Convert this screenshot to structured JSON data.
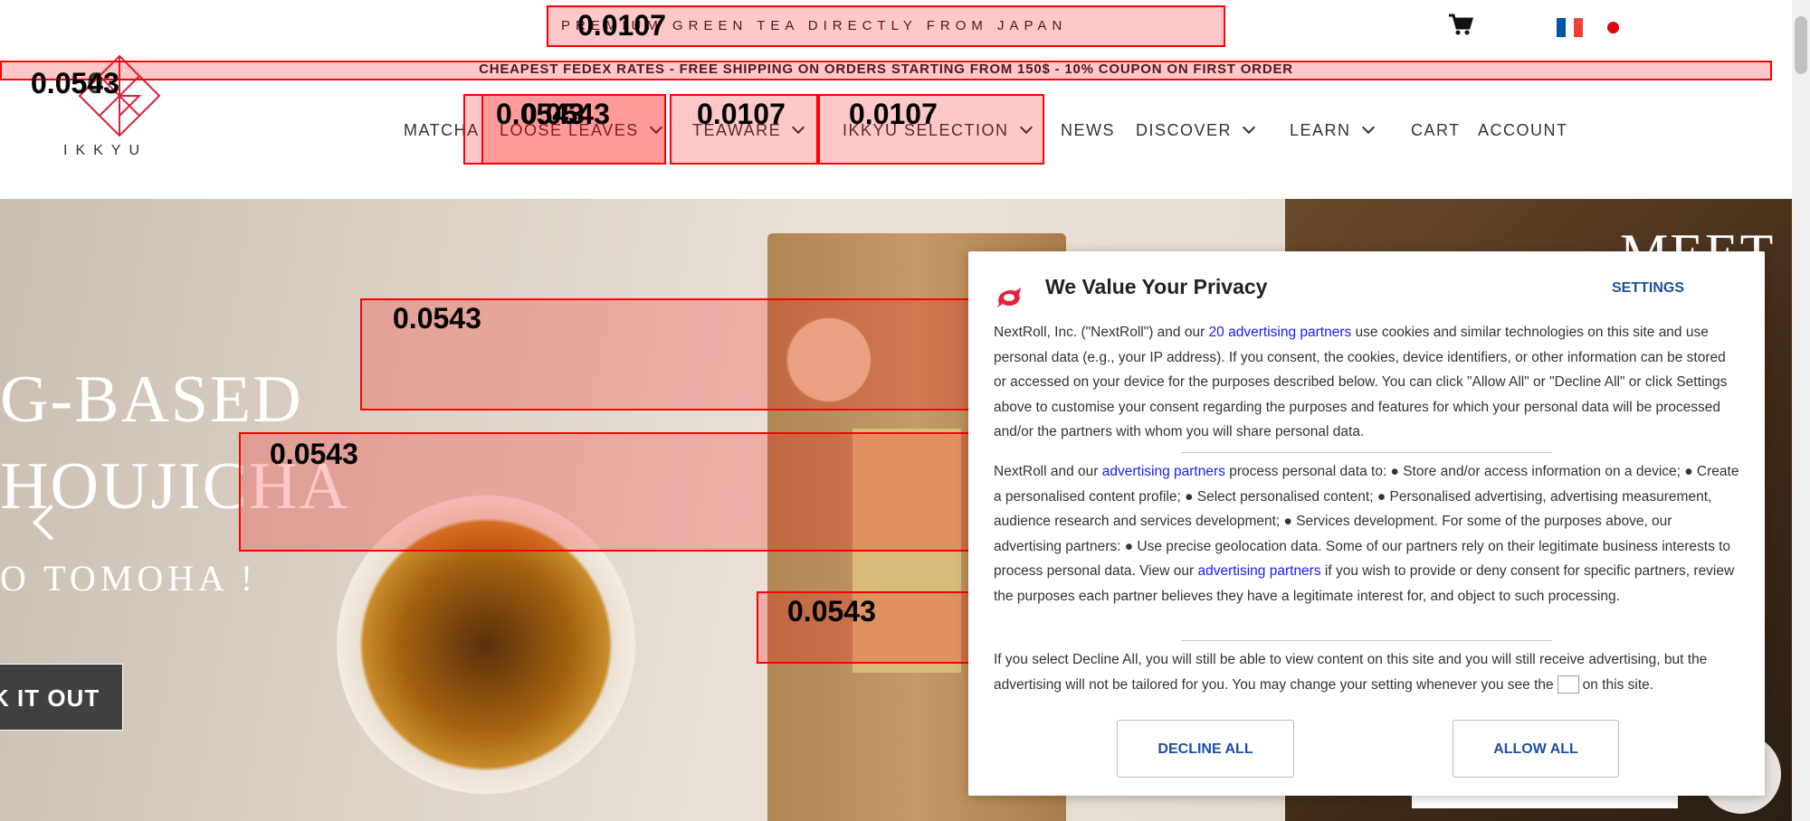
{
  "topbar": {
    "tagline": "PREMIUM GREEN TEA DIRECTLY FROM JAPAN"
  },
  "shipping": {
    "text": "CHEAPEST FEDEX RATES - FREE SHIPPING ON ORDERS STARTING FROM 150$ - 10% COUPON ON FIRST ORDER"
  },
  "brand": {
    "name": "IKKYU"
  },
  "nav": {
    "items": [
      {
        "label": "MATCHA"
      },
      {
        "label": "LOOSE LEAVES"
      },
      {
        "label": "TEAWARE"
      },
      {
        "label": "IKKYU SELECTION"
      },
      {
        "label": "NEWS"
      },
      {
        "label": "DISCOVER"
      },
      {
        "label": "LEARN"
      },
      {
        "label": "CART"
      },
      {
        "label": "ACCOUNT"
      }
    ]
  },
  "hero": {
    "line1": "G-BASED",
    "line2": "HOUJICHA",
    "line3": "O TOMOHA !",
    "button": "K IT OUT",
    "right_title": "MEET"
  },
  "overlay_labels": [
    "0.0107",
    "0.0543",
    "0.0503",
    "0.0543",
    "0.0107",
    "0.0107",
    "0.0543",
    "0.0543",
    "0.0543",
    "0.0543"
  ],
  "modal": {
    "title": "We Value Your Privacy",
    "settings": "SETTINGS",
    "p1_a": "NextRoll, Inc. (\"NextRoll\") and our ",
    "p1_link": "20 advertising partners",
    "p1_b": " use cookies and similar technologies on this site and use personal data (e.g., your IP address). If you consent, the cookies, device identifiers, or other information can be stored or accessed on your device for the purposes described below. You can click \"Allow All\" or \"Decline All\" or click Settings above to customise your consent regarding the purposes and features for which your personal data will be processed and/or the partners with whom you will share personal data.",
    "p2_a": "NextRoll and our ",
    "p2_link1": "advertising partners",
    "p2_b": " process personal data to: ● Store and/or access information on a device; ● Create a personalised content profile; ● Select personalised content; ● Personalised advertising, advertising measurement, audience research and services development; ● Services development. For some of the purposes above, our advertising partners: ● Use precise geolocation data. Some of our partners rely on their legitimate business interests to process personal data. View our ",
    "p2_link2": "advertising partners",
    "p2_c": " if you wish to provide or deny consent for specific partners, review the purposes each partner believes they have a legitimate interest for, and object to such processing.",
    "p3_a": "If you select Decline All, you will still be able to view content on this site and you will still receive advertising, but the advertising will not be tailored for you. You may change your setting whenever you see the",
    "p3_b": "on this site.",
    "decline": "DECLINE ALL",
    "allow": "ALLOW ALL"
  },
  "colors": {
    "accent_red": "#e00012",
    "link_blue": "#1a1aff",
    "button_blue": "#1d4fa1",
    "overlay_red": "#ff0000"
  },
  "icons": {
    "cart": "cart-icon",
    "flag_fr": "france-flag-icon",
    "flag_jp": "japan-flag-icon",
    "prev": "chevron-left-icon",
    "consent": "nextroll-logo-icon"
  }
}
